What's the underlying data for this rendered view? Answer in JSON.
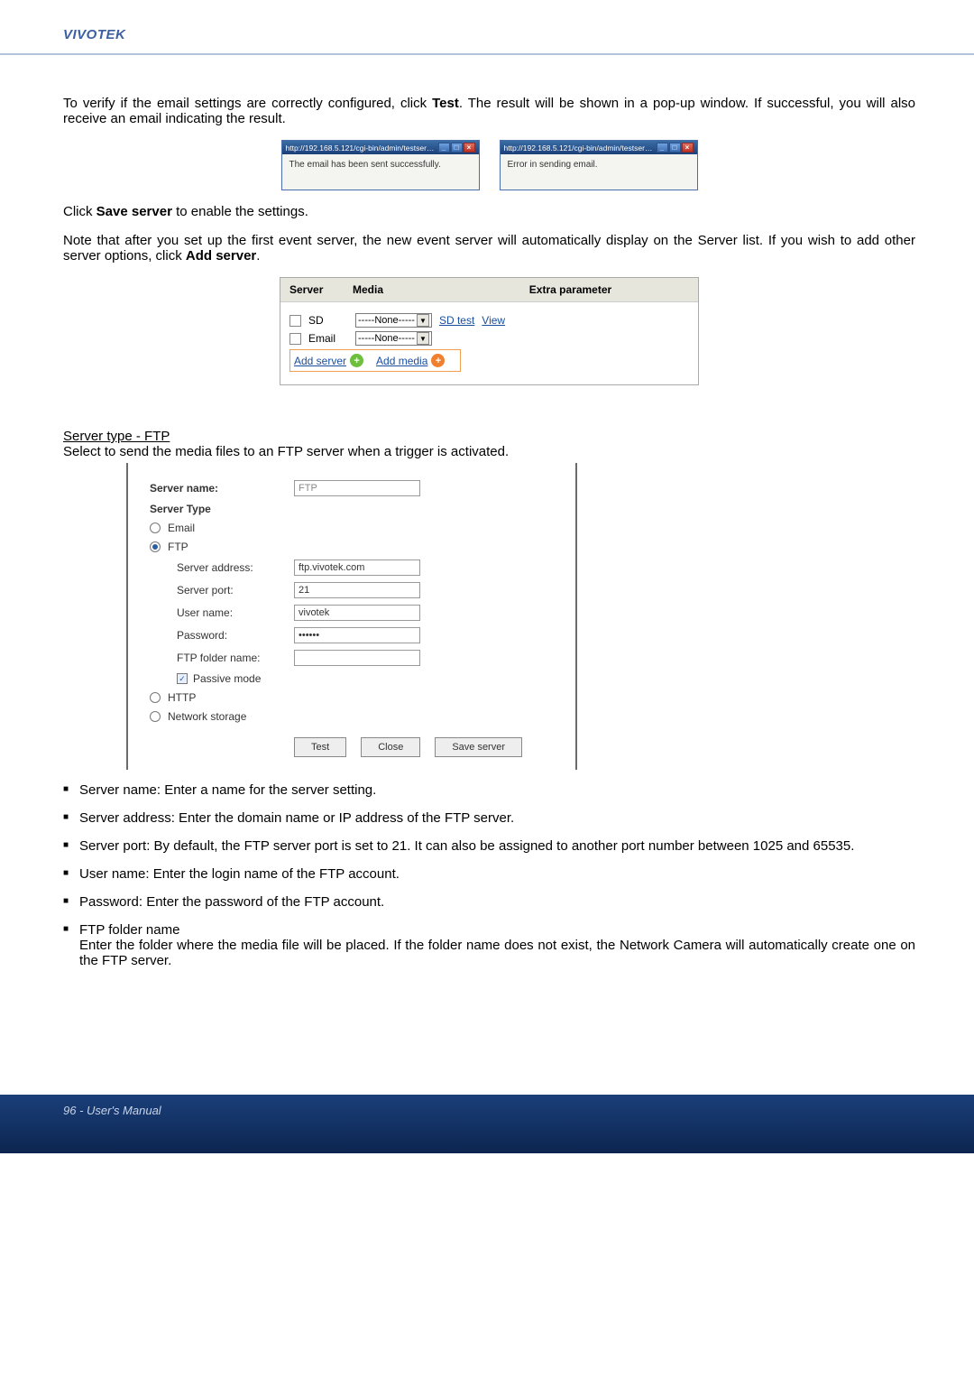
{
  "header": {
    "brand": "VIVOTEK"
  },
  "intro": {
    "p1a": "To verify if the email settings are correctly configured, click ",
    "p1b": "Test",
    "p1c": ". The result will be shown in a pop-up window. If successful, you will also receive an email indicating the result."
  },
  "popups": {
    "left": {
      "title": "http://192.168.5.121/cgi-bin/admin/testserver.cgi - ...",
      "body": "The email has been sent successfully."
    },
    "right": {
      "title": "http://192.168.5.121/cgi-bin/admin/testserver.cgi - ...",
      "body": "Error in sending email."
    }
  },
  "save": {
    "a": "Click ",
    "b": "Save server",
    "c": " to enable the settings."
  },
  "note": {
    "a": "Note that after you set up the first event server, the new event server will automatically display on the Server list.  If you wish to add other server options, click ",
    "b": "Add server",
    "c": "."
  },
  "serverPanel": {
    "h1": "Server",
    "h2": "Media",
    "h3": "Extra parameter",
    "row1": {
      "label": "SD",
      "select": "-----None-----",
      "link1": "SD test",
      "link2": "View"
    },
    "row2": {
      "label": "Email",
      "select": "-----None-----"
    },
    "addServer": "Add server",
    "addMedia": "Add media"
  },
  "ftpTitle": "Server type - FTP",
  "ftpIntro": "Select to send the media files to an FTP server when a trigger is activated.",
  "ftpForm": {
    "serverNameLabel": "Server name:",
    "serverName": "FTP",
    "serverTypeTitle": "Server Type",
    "optEmail": "Email",
    "optFTP": "FTP",
    "serverAddressLabel": "Server address:",
    "serverAddress": "ftp.vivotek.com",
    "serverPortLabel": "Server port:",
    "serverPort": "21",
    "userNameLabel": "User name:",
    "userName": "vivotek",
    "passwordLabel": "Password:",
    "password": "••••••",
    "ftpFolderLabel": "FTP folder name:",
    "ftpFolder": "",
    "passive": "Passive mode",
    "optHTTP": "HTTP",
    "optNetwork": "Network storage",
    "btnTest": "Test",
    "btnClose": "Close",
    "btnSave": "Save server"
  },
  "bullets": {
    "b1": "Server name: Enter a name for the server setting.",
    "b2": "Server address: Enter the domain name or IP address of the FTP server.",
    "b3": "Server port: By default, the FTP server port is set to 21. It can also be assigned to another port number between 1025 and 65535.",
    "b4": "User name: Enter the login name of the FTP account.",
    "b5": "Password: Enter the password of the FTP account.",
    "b6a": "FTP folder name",
    "b6b": "Enter the folder where the media file will be placed. If the folder name does not exist, the Network Camera will automatically create one on the FTP server."
  },
  "footer": "96 - User's Manual"
}
